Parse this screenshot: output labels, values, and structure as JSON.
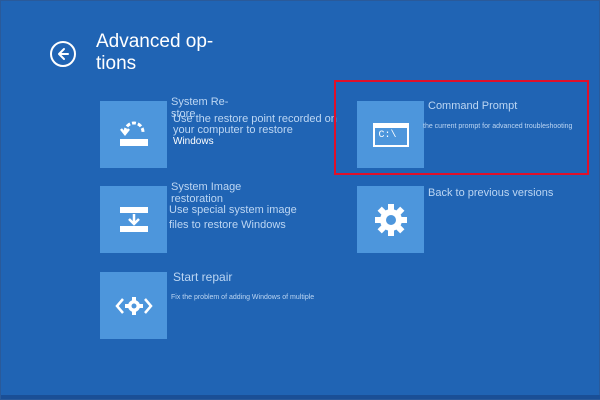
{
  "header": {
    "title_line1": "Advanced op-",
    "title_line2": "tions"
  },
  "options": [
    {
      "id": "system-restore",
      "title_line1": "System Re-",
      "title_line2": "store",
      "desc_line1": "Use the restore point recorded on",
      "desc_line2": "your computer to restore",
      "desc_line3": "Windows",
      "icon": "restore-icon"
    },
    {
      "id": "command-prompt",
      "title": "Command Prompt",
      "desc": "the current prompt for advanced troubleshooting",
      "icon_text": "C:\\",
      "icon": "command-prompt-icon"
    },
    {
      "id": "system-image-recovery",
      "title_line1": "System Image",
      "title_line2": "restoration",
      "desc_line1": "Use special system image",
      "desc_line2": "files to restore Windows",
      "icon": "image-restore-icon"
    },
    {
      "id": "back-to-previous",
      "title": "Back to previous versions",
      "icon": "gear-icon"
    },
    {
      "id": "start-repair",
      "title": "Start repair",
      "desc": "Fix the problem of adding Windows of multiple",
      "icon": "repair-icon"
    }
  ],
  "colors": {
    "background": "#2064b4",
    "tile": "#4d96dc",
    "highlight": "#e0102a",
    "text": "#ffffff"
  }
}
